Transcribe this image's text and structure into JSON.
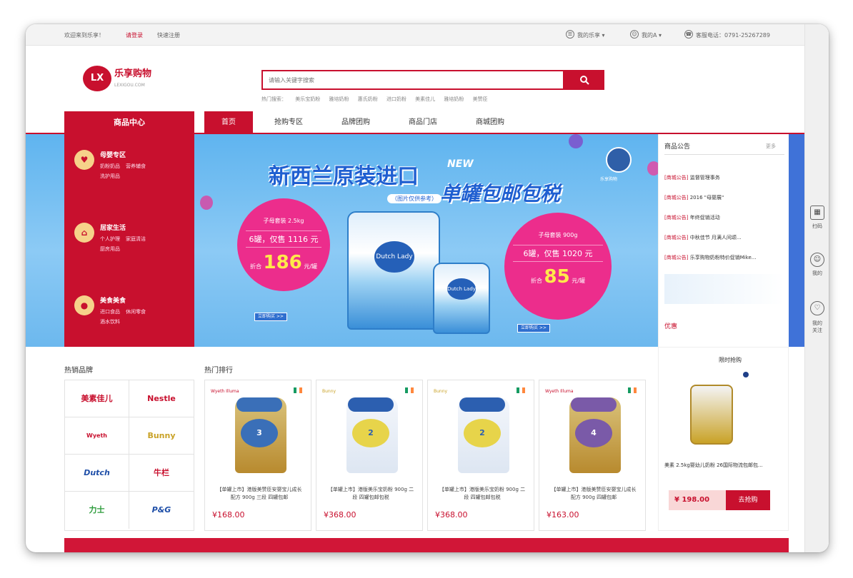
{
  "topbar": {
    "welcome": "欢迎来到乐享！",
    "login": "请登录",
    "register": "快速注册",
    "links": [
      "我的乐享 ▾",
      "我的A ▾",
      "客服电话：0791-25267289"
    ]
  },
  "logo": {
    "mark": "LX",
    "name": "乐享购物",
    "domain": "LEXIGOU.COM"
  },
  "search": {
    "placeholder": "请输入关键字搜索",
    "button_icon": "search-icon",
    "hotwords": [
      "热门搜索：",
      "美乐宝奶粉",
      "雅培奶粉",
      "惠氏奶粉",
      "进口奶粉",
      "美素佳儿",
      "雅培奶粉",
      "美赞臣"
    ]
  },
  "nav": {
    "category_head": "商品中心",
    "items": [
      "首页",
      "抢购专区",
      "品牌团购",
      "商品门店",
      "商城团购"
    ]
  },
  "categories": [
    {
      "icon": "baby-icon",
      "title": "母婴专区",
      "subs": [
        "奶粉奶品",
        "营养辅食",
        "洗护用品"
      ]
    },
    {
      "icon": "home-icon",
      "title": "居家生活",
      "subs": [
        "个人护理",
        "家庭清洁",
        "厨房用品"
      ]
    },
    {
      "icon": "food-icon",
      "title": "美食美食",
      "subs": [
        "进口食品",
        "休闲零食",
        "酒水饮料"
      ]
    }
  ],
  "banner": {
    "title": "新西兰原装进口",
    "new_tag": "NEW",
    "subtitle": "单罐包邮包税",
    "note": "（图片仅供参考）",
    "left_bubble": {
      "line1": "子母套装 2.5kg",
      "line2": "6罐，仅售 1116 元",
      "prefix": "折合",
      "price": "186",
      "unit": "元/罐"
    },
    "right_bubble": {
      "line1": "子母套装 900g",
      "line2": "6罐，仅售 1020 元",
      "prefix": "折合",
      "price": "85",
      "unit": "元/罐"
    },
    "buy_left": "立即购买 >>",
    "buy_right": "立即购买 >>",
    "can_label": "Dutch Lady",
    "small_can_label": "Dutch Lady",
    "corner_logo": "乐享购物"
  },
  "notice": {
    "title": "商品公告",
    "more": "更多",
    "items": [
      {
        "tag": "[商城公告]",
        "text": "监督管理事务"
      },
      {
        "tag": "[商城公告]",
        "text": "2016 \"母婴展\""
      },
      {
        "tag": "[商城公告]",
        "text": "年终促销活动"
      },
      {
        "tag": "[商城公告]",
        "text": "中秋佳节 月满人间颂..."
      },
      {
        "tag": "[商城公告]",
        "text": "乐享购物奶粉特价促销Mike..."
      }
    ],
    "footer": "优惠"
  },
  "sidebar": [
    {
      "icon": "qrcode-icon",
      "label": "扫码"
    },
    {
      "icon": "user-icon",
      "label": "我的"
    },
    {
      "icon": "heart-icon",
      "label": "我的关注"
    }
  ],
  "brands": {
    "title": "热销品牌",
    "items": [
      "美素佳儿",
      "Nestle",
      "Wyeth",
      "Bunny",
      "Dutch",
      "牛栏",
      "力士",
      "P&G"
    ]
  },
  "hot": {
    "title": "热门排行",
    "products": [
      {
        "brand": "Wyeth Illuma",
        "name": "【单罐上市】港版美赞臣安婴宝儿成长配方 900g 三段 四罐包邮",
        "price": "¥168.00"
      },
      {
        "brand": "Bunny",
        "name": "【单罐上市】港版美乐宝奶粉 900g 二段 四罐包邮包税",
        "price": "¥368.00"
      },
      {
        "brand": "Bunny",
        "name": "【单罐上市】港版美乐宝奶粉 900g 二段 四罐包邮包税",
        "price": "¥368.00"
      },
      {
        "brand": "Wyeth Illuma",
        "name": "【单罐上市】港版美赞臣安婴宝儿成长配方 900g 四罐包邮",
        "price": "¥163.00"
      }
    ]
  },
  "promo": {
    "title": "限时抢购",
    "name": "美素 2.5kg婴幼儿奶粉 26国际物流包邮包...",
    "price": "¥ 198.00",
    "button": "去抢购"
  },
  "colors": {
    "brand_red": "#c8102e",
    "banner_blue": "#5fb4ef",
    "bubble_pink": "#ec2d8c"
  }
}
